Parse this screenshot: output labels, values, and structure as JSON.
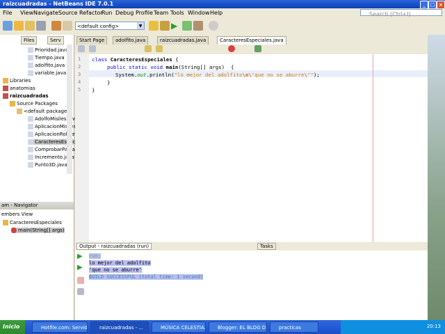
{
  "window": {
    "title": "raizcuadradas - NetBeans IDE 7.0.1"
  },
  "menu": [
    "File",
    "View",
    "Navigate",
    "Source",
    "Refactor",
    "Run",
    "Debug",
    "Profile",
    "Team",
    "Tools",
    "Window",
    "Help"
  ],
  "search": {
    "placeholder": "Search (Ctrl+I)"
  },
  "toolbar": {
    "config_value": "<default config>"
  },
  "projects": {
    "tabs": [
      "Files",
      "Serv"
    ],
    "items": [
      "Prioridad.java",
      "Tiempo.java",
      "adolfito.java",
      "variable.java",
      "Libraries",
      "anatomias",
      "raizcuadradas",
      "Source Packages",
      "<default package>",
      "AdolfoMisiles.java",
      "AplicacionMisiles.java",
      "AplicacionRoll.java",
      "CaracteresEspeciales.java",
      "ComprobarPar.java",
      "Incremento.java",
      "Punto3D.java"
    ]
  },
  "navigator": {
    "title": "am - Navigator",
    "view": "embers View",
    "class_name": "CaracteresEspeciales",
    "method": "main(String[] args)"
  },
  "editor": {
    "tabs": [
      "Start Page",
      "adolfito.java",
      "raizcuadradas.java",
      "CaracteresEspeciales.java"
    ],
    "line_numbers": [
      "1",
      "2",
      "3",
      "4",
      "5"
    ],
    "code": {
      "l1_kw": "class ",
      "l1_name": "CaracteresEspeciales",
      "l1_rest": " {",
      "l2_kw": "public static void ",
      "l2_name": "main",
      "l2_rest": "(String[] args)  {",
      "l3_pre": "System.",
      "l3_out": "out",
      "l3_mid": ".println(",
      "l3_str1": "\"lo mejor del adolfito",
      "l3_esc1": "\\n",
      "l3_esc2": "\\'",
      "l3_str2": "que no se aburre",
      "l3_esc3": "\\'",
      "l3_str3": "\"",
      "l3_end": ");",
      "l4": "}",
      "l5": "}"
    }
  },
  "output": {
    "title": "Output - raizcuadradas (run)",
    "tasks_tab": "Tasks",
    "lines": [
      "run:",
      "lo mejor del adolfito",
      "'que no se aburre'",
      "BUILD SUCCESSFUL (total time: 1 second)"
    ]
  },
  "taskbar": {
    "start": "Inicio",
    "tasks": [
      "Hotfile.com: Servido...",
      "raizcuadradas - ...",
      "MÚSICA CELESTIA...",
      "Blogger: EL BLOG D...",
      "practicas"
    ],
    "clock": "20:13"
  }
}
